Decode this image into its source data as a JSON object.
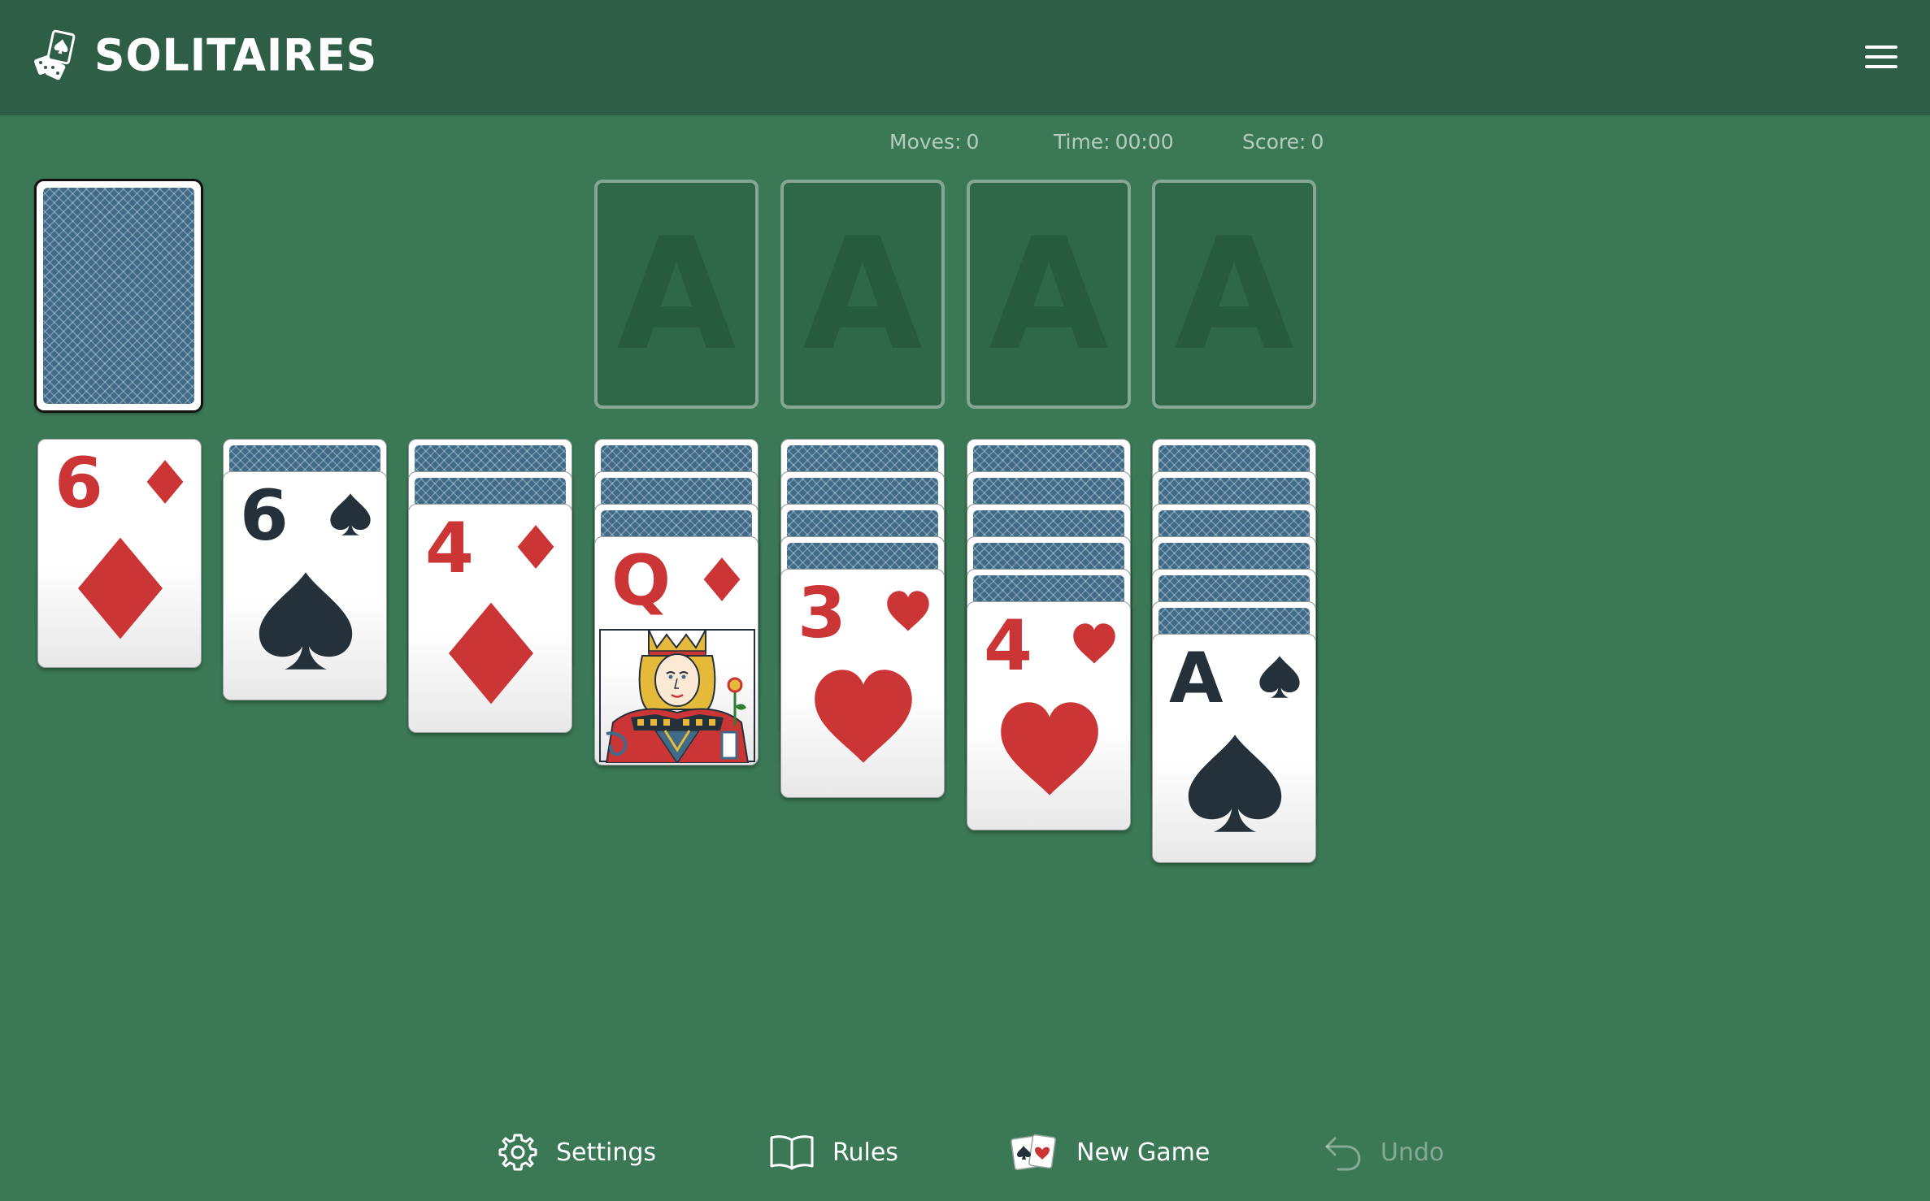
{
  "header": {
    "logo_text": "SOLITAIRES",
    "logo_icon": "cards-and-dice-icon",
    "menu_icon": "hamburger-menu-icon"
  },
  "stats": {
    "moves_label": "Moves:",
    "moves_value": "0",
    "time_label": "Time:",
    "time_value": "00:00",
    "score_label": "Score:",
    "score_value": "0"
  },
  "foundations": [
    {
      "placeholder": "A"
    },
    {
      "placeholder": "A"
    },
    {
      "placeholder": "A"
    },
    {
      "placeholder": "A"
    }
  ],
  "tableau": [
    {
      "face_down_count": 0,
      "top": {
        "rank": "6",
        "suit": "diamonds"
      }
    },
    {
      "face_down_count": 1,
      "top": {
        "rank": "6",
        "suit": "spades"
      }
    },
    {
      "face_down_count": 2,
      "top": {
        "rank": "4",
        "suit": "diamonds"
      }
    },
    {
      "face_down_count": 3,
      "top": {
        "rank": "Q",
        "suit": "diamonds"
      }
    },
    {
      "face_down_count": 4,
      "top": {
        "rank": "3",
        "suit": "hearts"
      }
    },
    {
      "face_down_count": 5,
      "top": {
        "rank": "4",
        "suit": "hearts"
      }
    },
    {
      "face_down_count": 6,
      "top": {
        "rank": "A",
        "suit": "spades"
      }
    }
  ],
  "toolbar": {
    "settings_label": "Settings",
    "rules_label": "Rules",
    "new_game_label": "New Game",
    "undo_label": "Undo"
  },
  "colors": {
    "table_green": "#3b7856",
    "header_green": "#2e5e45",
    "red_suit": "#cc3535",
    "black_suit": "#24313a",
    "card_back_blue": "#3f6a88"
  }
}
